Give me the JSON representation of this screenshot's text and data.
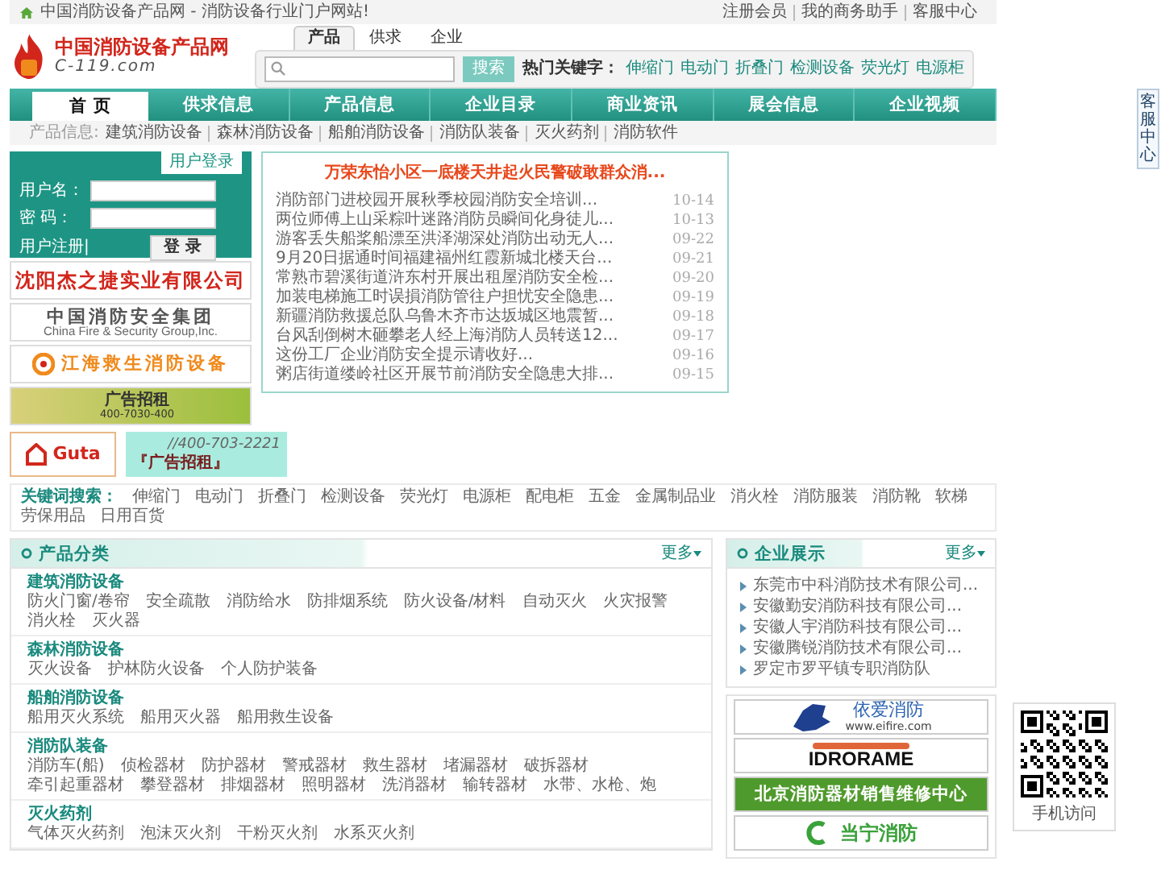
{
  "top_bar": {
    "site_title": "中国消防设备产品网 - 消防设备行业门户网站!",
    "links": [
      "注册会员",
      "我的商务助手",
      "客服中心"
    ]
  },
  "logo": {
    "name": "中国消防设备产品网",
    "domain": "C-119.com"
  },
  "search": {
    "tabs": [
      {
        "label": "产品",
        "selected": true
      },
      {
        "label": "供求",
        "selected": false
      },
      {
        "label": "企业",
        "selected": false
      }
    ],
    "button": "搜索",
    "hot_label": "热门关键字：",
    "hot_keywords": [
      "伸缩门",
      "电动门",
      "折叠门",
      "检测设备",
      "荧光灯",
      "电源柜"
    ]
  },
  "nav": [
    {
      "label": "首 页",
      "selected": true
    },
    {
      "label": "供求信息",
      "selected": false
    },
    {
      "label": "产品信息",
      "selected": false
    },
    {
      "label": "企业目录",
      "selected": false
    },
    {
      "label": "商业资讯",
      "selected": false
    },
    {
      "label": "展会信息",
      "selected": false
    },
    {
      "label": "企业视频",
      "selected": false
    }
  ],
  "sub_nav": {
    "label": "产品信息:",
    "items": [
      "建筑消防设备",
      "森林消防设备",
      "船舶消防设备",
      "消防队装备",
      "灭火药剂",
      "消防软件"
    ]
  },
  "login": {
    "title": "用户登录",
    "username_label": "用户名：",
    "password_label": "密 码：",
    "register_link": "用户注册|",
    "button": "登 录"
  },
  "ad_banners": [
    {
      "kind": "red-title",
      "lines": [
        "沈阳杰之捷实业有限公司"
      ]
    },
    {
      "kind": "bilingual",
      "lines": [
        "中国消防安全集团",
        "China Fire & Security Group,Inc."
      ]
    },
    {
      "kind": "emblem",
      "lines": [
        "江海救生消防设备"
      ]
    },
    {
      "kind": "grass",
      "lines": [
        "广告招租",
        "400-7030-400"
      ]
    }
  ],
  "news": {
    "headline": "万荣东怡小区一底楼天井起火民警破敢群众消...",
    "items": [
      {
        "title": "消防部门进校园开展秋季校园消防安全培训...",
        "date": "10-14"
      },
      {
        "title": "两位师傅上山采粽叶迷路消防员瞬间化身徒儿...",
        "date": "10-13"
      },
      {
        "title": "游客丢失船桨船漂至洪泽湖深处消防出动无人...",
        "date": "09-22"
      },
      {
        "title": "9月20日据通时间福建福州红霞新城北楼天台...",
        "date": "09-21"
      },
      {
        "title": "常熟市碧溪街道浒东村开展出租屋消防安全检...",
        "date": "09-20"
      },
      {
        "title": "加装电梯施工时误損消防管往户担忧安全隐患...",
        "date": "09-19"
      },
      {
        "title": "新疆消防救援总队乌鲁木齐市达坂城区地震暂...",
        "date": "09-18"
      },
      {
        "title": "台风刮倒树木砸攀老人经上海消防人员转送12...",
        "date": "09-17"
      },
      {
        "title": "这份工厂企业消防安全提示请收好...",
        "date": "09-16"
      },
      {
        "title": "粥店街道缕岭社区开展节前消防安全隐患大排...",
        "date": "09-15"
      }
    ]
  },
  "bottom_ads": [
    {
      "kind": "house-logo",
      "lines": [
        "Guta"
      ]
    },
    {
      "kind": "phone-ad",
      "lines": [
        "//400-703-2221",
        "『广告招租』"
      ]
    }
  ],
  "keywords": {
    "label": "关键词搜索：",
    "items": [
      "伸缩门",
      "电动门",
      "折叠门",
      "检测设备",
      "荧光灯",
      "电源柜",
      "配电柜",
      "五金",
      "金属制品业",
      "消火栓",
      "消防服装",
      "消防靴",
      "软梯",
      "劳保用品",
      "日用百货"
    ]
  },
  "categories": {
    "title": "产品分类",
    "more": "更多",
    "groups": [
      {
        "title": "建筑消防设备",
        "items": [
          "防火门窗/卷帘",
          "安全疏散",
          "消防给水",
          "防排烟系统",
          "防火设备/材料",
          "自动灭火",
          "火灾报警",
          "消火栓",
          "灭火器"
        ]
      },
      {
        "title": "森林消防设备",
        "items": [
          "灭火设备",
          "护林防火设备",
          "个人防护装备"
        ]
      },
      {
        "title": "船舶消防设备",
        "items": [
          "船用灭火系统",
          "船用灭火器",
          "船用救生设备"
        ]
      },
      {
        "title": "消防队装备",
        "items": [
          "消防车(船)",
          "侦检器材",
          "防护器材",
          "警戒器材",
          "救生器材",
          "堵漏器材",
          "破拆器材",
          "牵引起重器材",
          "攀登器材",
          "排烟器材",
          "照明器材",
          "洗消器材",
          "输转器材",
          "水带、水枪、炮"
        ]
      },
      {
        "title": "灭火药剂",
        "items": [
          "气体灭火药剂",
          "泡沫灭火剂",
          "干粉灭火剂",
          "水系灭火剂"
        ]
      }
    ]
  },
  "companies": {
    "title": "企业展示",
    "more": "更多",
    "items": [
      "东莞市中科消防技术有限公司...",
      "安徽勤安消防科技有限公司...",
      "安徽人宇消防科技有限公司...",
      "安徽腾锐消防技术有限公司...",
      "罗定市罗平镇专职消防队"
    ]
  },
  "company_banners": [
    {
      "kind": "map-logo",
      "lines": [
        "依爱消防",
        "www.eifire.com"
      ]
    },
    {
      "kind": "ring-logo",
      "lines": [
        "IDRORAME"
      ]
    },
    {
      "kind": "green-bar",
      "lines": [
        "北京消防器材销售维修中心"
      ]
    },
    {
      "kind": "letter-logo",
      "lines": [
        "当宁消防"
      ]
    }
  ],
  "qr": {
    "caption": "手机访问"
  },
  "service_tab": "客服中心"
}
